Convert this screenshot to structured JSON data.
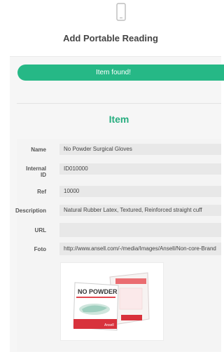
{
  "header": {
    "title": "Add Portable Reading",
    "icon": "smartphone-icon"
  },
  "alert": {
    "message": "Item found!"
  },
  "section": {
    "title": "Item"
  },
  "fields": {
    "name": {
      "label": "Name",
      "value": "No Powder Surgical Gloves"
    },
    "internal_id": {
      "label_line1": "Internal",
      "label_line2": "ID",
      "value": "ID010000"
    },
    "ref": {
      "label": "Ref",
      "value": "10000"
    },
    "description": {
      "label": "Description",
      "value": "Natural Rubber Latex, Textured, Reinforced straight cuff"
    },
    "url": {
      "label": "URL",
      "value": ""
    },
    "foto": {
      "label": "Foto",
      "value": "http://www.ansell.com/-/media/Images/Ansell/Non-core-Brand"
    }
  },
  "product_image": {
    "box_text": "NO POWDER",
    "brand": "Ansell"
  },
  "colors": {
    "accent": "#26b886",
    "title_green": "#27ad7f",
    "field_bg": "#e8e8e8"
  }
}
